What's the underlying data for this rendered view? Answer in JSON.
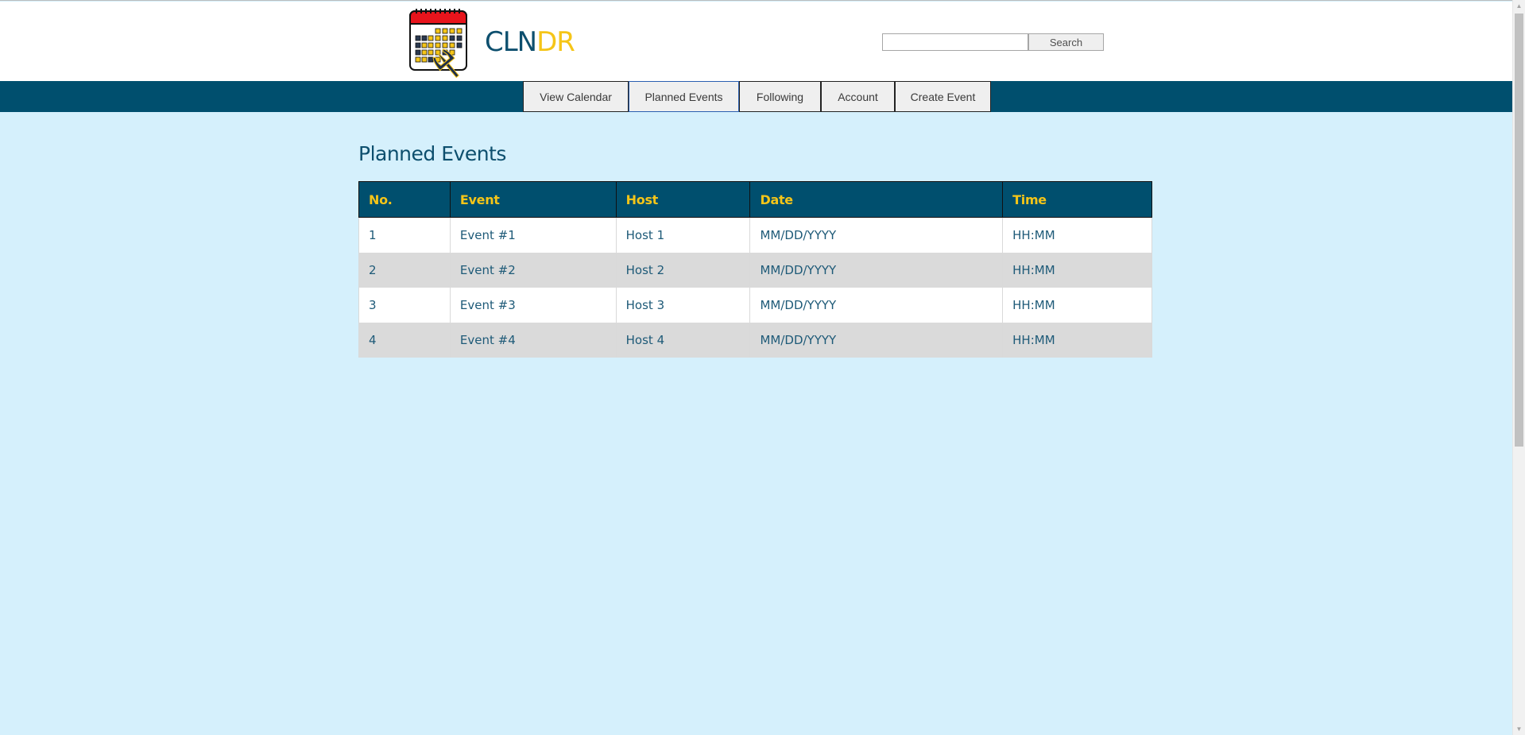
{
  "header": {
    "logo_text_a": "CLN",
    "logo_text_b": "DR",
    "search": {
      "placeholder": "",
      "value": "",
      "button_label": "Search"
    }
  },
  "nav": {
    "items": [
      {
        "label": "View Calendar"
      },
      {
        "label": "Planned Events"
      },
      {
        "label": "Following"
      },
      {
        "label": "Account"
      },
      {
        "label": "Create Event"
      }
    ],
    "active": "Planned Events"
  },
  "main": {
    "title": "Planned Events",
    "table": {
      "headers": [
        "No.",
        "Event",
        "Host",
        "Date",
        "Time"
      ],
      "rows": [
        [
          "1",
          "Event #1",
          "Host 1",
          "MM/DD/YYYY",
          "HH:MM"
        ],
        [
          "2",
          "Event #2",
          "Host 2",
          "MM/DD/YYYY",
          "HH:MM"
        ],
        [
          "3",
          "Event #3",
          "Host 3",
          "MM/DD/YYYY",
          "HH:MM"
        ],
        [
          "4",
          "Event #4",
          "Host 4",
          "MM/DD/YYYY",
          "HH:MM"
        ]
      ]
    }
  },
  "colors": {
    "brand_navy": "#004f6e",
    "brand_yellow": "#f5c518",
    "page_bg": "#d5f0fc",
    "calendar_red": "#e8141c"
  },
  "icons": {
    "logo": "calendar-trident-icon"
  }
}
